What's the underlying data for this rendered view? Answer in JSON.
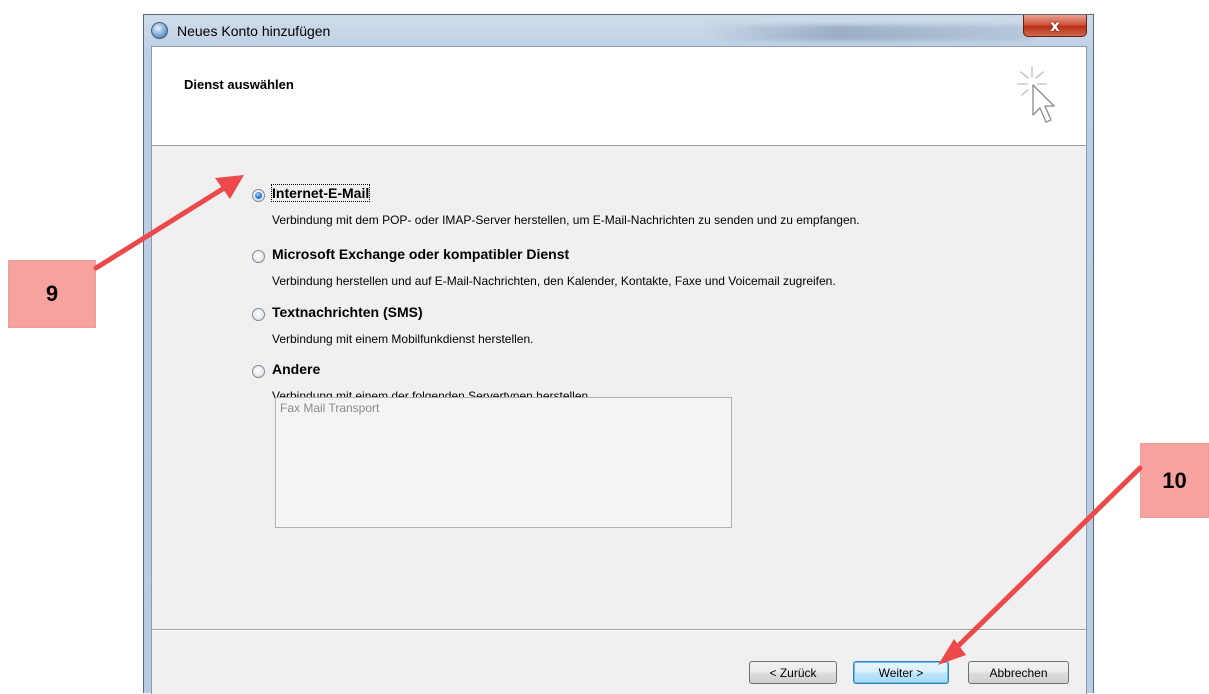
{
  "window": {
    "title": "Neues Konto hinzufügen",
    "close_label": "x"
  },
  "header": {
    "title": "Dienst auswählen"
  },
  "options": [
    {
      "label": "Internet-E-Mail",
      "description": "Verbindung mit dem POP- oder IMAP-Server herstellen, um E-Mail-Nachrichten zu senden und zu empfangen.",
      "selected": true
    },
    {
      "label": "Microsoft Exchange oder kompatibler Dienst",
      "description": "Verbindung herstellen und auf E-Mail-Nachrichten, den Kalender, Kontakte, Faxe und Voicemail zugreifen.",
      "selected": false
    },
    {
      "label": "Textnachrichten (SMS)",
      "description": "Verbindung mit einem Mobilfunkdienst herstellen.",
      "selected": false
    },
    {
      "label": "Andere",
      "description": "Verbindung mit einem der folgenden Servertypen herstellen.",
      "selected": false
    }
  ],
  "server_types": [
    "Fax Mail Transport"
  ],
  "buttons": {
    "back": "< Zurück",
    "next": "Weiter >",
    "cancel": "Abbrechen"
  },
  "annotations": {
    "step_9": "9",
    "step_10": "10",
    "color": "#f6a3a0",
    "arrow_color": "#ec4a4a"
  },
  "colors": {
    "window_frame": "#bccfe4",
    "close_button": "#c8452b",
    "client_background": "#f0f0f0",
    "radio_selected": "#2a73c7"
  },
  "icons": {
    "title": "outlook-globe-icon",
    "header": "wizard-pointer-icon"
  }
}
